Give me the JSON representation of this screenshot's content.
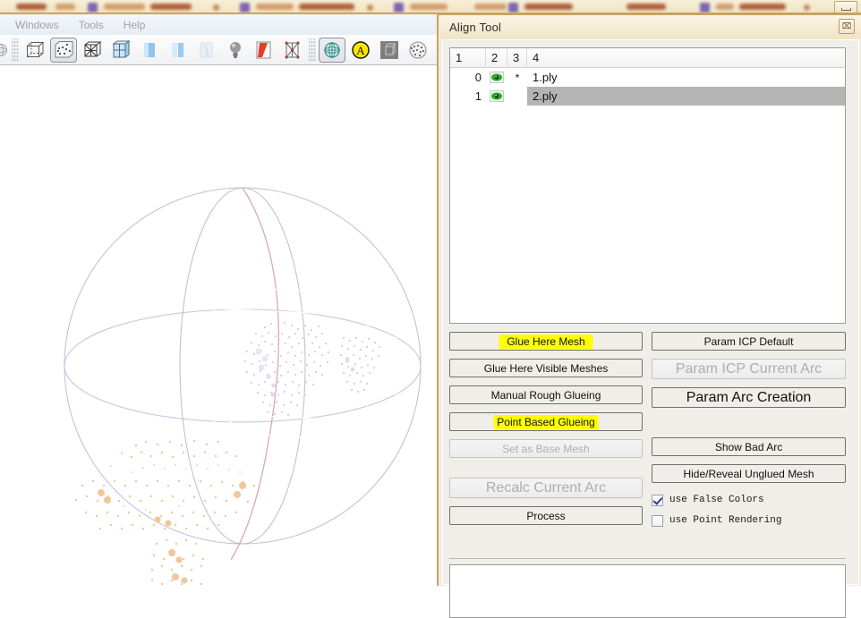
{
  "window": {
    "minimize_label": "minimize",
    "tabstrip_note": "blurred browser tab bar"
  },
  "app": {
    "menubar": [
      "Windows",
      "Tools",
      "Help"
    ],
    "toolbar_left": [
      "partial-sphere-icon",
      "bounding-box-icon",
      "point-cloud-box-icon",
      "wireframe-box-icon",
      "flat-lines-box-icon",
      "smooth-shading-icon",
      "flat-shading-icon",
      "transparent-shading-icon",
      "light-bulb-icon",
      "double-side-color-icon",
      "vertex-quality-icon"
    ],
    "toolbar_right": [
      "trackball-icon",
      "align-tool-icon",
      "measure-icon",
      "point-set-icon"
    ],
    "toolbar_pressed": [
      "point-cloud-box-icon",
      "trackball-icon"
    ]
  },
  "viewport": {
    "name": "3d-point-cloud-viewport",
    "bg_top": "#000000",
    "bg_bottom": "#7373bb",
    "cloud_a_color": "#c9c9e8",
    "cloud_b_color": "#f0c79a",
    "trackball_color": "#c8c8d8",
    "trackball_highlight_color": "#d9a0a8",
    "bbox_color": "#ffffff"
  },
  "align_tool": {
    "title": "Align Tool",
    "close_label": "⌧",
    "list": {
      "headers": [
        "1",
        "2",
        "3",
        "4"
      ],
      "rows": [
        {
          "index": "0",
          "visible_icon": "eye-icon",
          "flag": "*",
          "name": "1.ply",
          "selected": false
        },
        {
          "index": "1",
          "visible_icon": "eye-icon",
          "flag": "",
          "name": "2.ply",
          "selected": true
        }
      ]
    },
    "buttons_left": [
      {
        "label": "Glue Here Mesh",
        "disabled": false,
        "highlight": true,
        "hl_width": 105
      },
      {
        "label": "Glue Here Visible Meshes",
        "disabled": false,
        "highlight": false
      },
      {
        "label": "Manual Rough Glueing",
        "disabled": false,
        "highlight": false
      },
      {
        "label": "Point Based Glueing",
        "disabled": false,
        "highlight": true,
        "hl_width": 117
      },
      {
        "label": "Set as Base Mesh",
        "disabled": true,
        "highlight": false
      },
      {
        "label": "Recalc Current Arc",
        "disabled": true,
        "highlight": false,
        "big": true
      },
      {
        "label": "Process",
        "disabled": false,
        "highlight": false
      }
    ],
    "buttons_right": [
      {
        "label": "Param ICP Default",
        "disabled": false,
        "highlight": false
      },
      {
        "label": "Param ICP Current Arc",
        "disabled": true,
        "highlight": false,
        "big": true
      },
      {
        "label": "Param Arc Creation",
        "disabled": false,
        "highlight": false,
        "big": true
      },
      {
        "label": "Show Bad Arc",
        "disabled": false,
        "highlight": false
      },
      {
        "label": "Hide/Reveal Unglued Mesh",
        "disabled": false,
        "highlight": false
      }
    ],
    "checkboxes": [
      {
        "label": "use False Colors",
        "checked": true
      },
      {
        "label": "use Point Rendering",
        "checked": false
      }
    ],
    "log_text": ""
  },
  "colors": {
    "highlight_yellow": "#ffff00",
    "window_chrome": "#c9a45e",
    "selection_gray": "#b4b4b4",
    "eye_green": "#2fa62f"
  }
}
